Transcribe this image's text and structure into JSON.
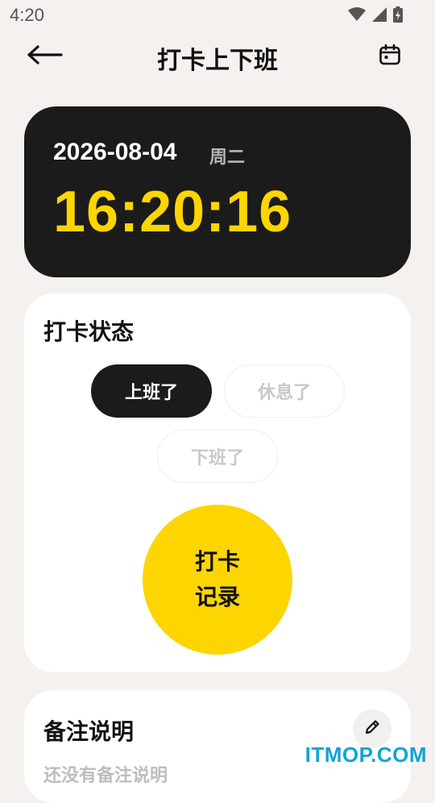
{
  "status_bar": {
    "time": "4:20",
    "icons": [
      "wifi-icon",
      "signal-icon",
      "battery-charging-icon"
    ]
  },
  "app_bar": {
    "title": "打卡上下班",
    "back_icon": "arrow-left-icon",
    "calendar_icon": "calendar-icon"
  },
  "clock": {
    "date": "2026-08-04",
    "weekday": "周二",
    "time": "16:20:16"
  },
  "status_section": {
    "title": "打卡状态",
    "options": [
      {
        "label": "上班了",
        "selected": true
      },
      {
        "label": "休息了",
        "selected": false
      },
      {
        "label": "下班了",
        "selected": false
      }
    ],
    "punch_line1": "打卡",
    "punch_line2": "记录"
  },
  "notes_section": {
    "title": "备注说明",
    "empty_text": "还没有备注说明",
    "edit_icon": "pencil-icon"
  },
  "watermark": "ITMOP.COM",
  "colors": {
    "background": "#f5f1ee",
    "accent_yellow": "#fdd501",
    "dark": "#1b1b1b"
  }
}
